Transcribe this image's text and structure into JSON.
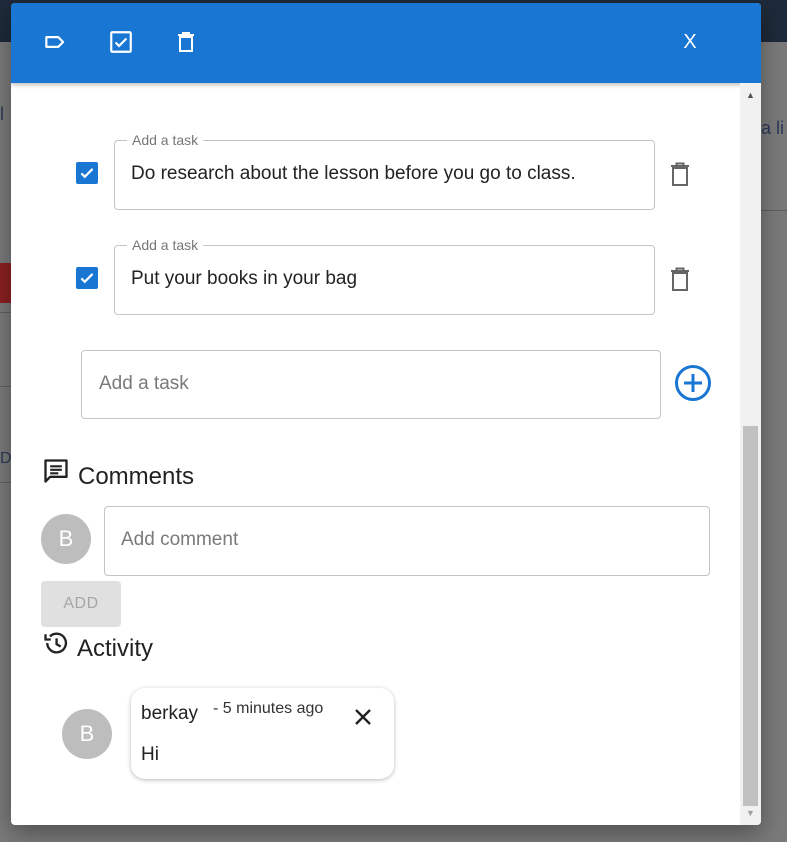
{
  "background": {
    "fragments": [
      "l",
      "a li",
      "0!",
      "D"
    ]
  },
  "header": {
    "icons": [
      "label-icon",
      "checkbox-icon",
      "trash-icon"
    ],
    "close_label": "X"
  },
  "checklist": {
    "items": [
      {
        "legend": "Add a task",
        "value": "Do research about the lesson before you go to class.",
        "checked": true
      },
      {
        "legend": "Add a task",
        "value": "Put your books in your bag",
        "checked": true
      }
    ],
    "new_task_placeholder": "Add a task"
  },
  "comments": {
    "title": "Comments",
    "avatar_initial": "B",
    "placeholder": "Add comment",
    "add_label": "ADD"
  },
  "activity": {
    "title": "Activity",
    "avatar_initial": "B",
    "entries": [
      {
        "user": "berkay",
        "time": "- 5 minutes ago",
        "text": "Hi"
      }
    ]
  },
  "colors": {
    "primary": "#1976d2",
    "avatar": "#bdbdbd"
  }
}
